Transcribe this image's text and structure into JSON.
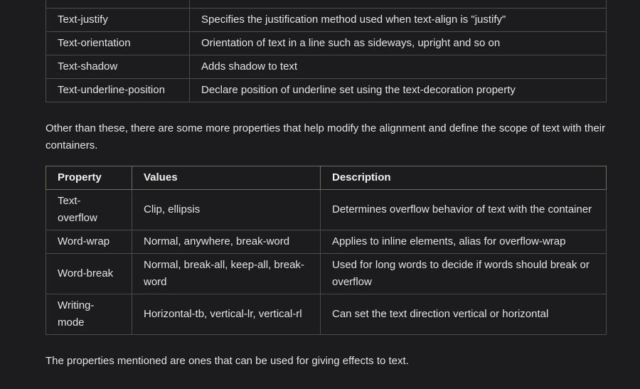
{
  "table1": {
    "rows": [
      {
        "property": "Text-justify",
        "description": "Specifies the justification method used when text-align is \"justify\""
      },
      {
        "property": "Text-orientation",
        "description": "Orientation of text in a line such as sideways, upright and so on"
      },
      {
        "property": "Text-shadow",
        "description": "Adds shadow to text"
      },
      {
        "property": "Text-underline-position",
        "description": "Declare position of underline set using the text-decoration property"
      }
    ]
  },
  "paragraph1": "Other than these, there are some more properties that help modify the alignment and define the scope of text with their containers.",
  "table2": {
    "headers": {
      "property": "Property",
      "values": "Values",
      "description": "Description"
    },
    "rows": [
      {
        "property": "Text-overflow",
        "values": "Clip, ellipsis",
        "description": "Determines overflow behavior of text with the container"
      },
      {
        "property": "Word-wrap",
        "values": "Normal, anywhere, break-word",
        "description": "Applies to inline elements, alias for overflow-wrap"
      },
      {
        "property": "Word-break",
        "values": "Normal, break-all, keep-all, break-word",
        "description": "Used for long words to decide if words should break or overflow"
      },
      {
        "property": "Writing-mode",
        "values": "Horizontal-tb, vertical-lr, vertical-rl",
        "description": "Can set the text direction vertical or horizontal"
      }
    ]
  },
  "paragraph2": "The properties mentioned are ones that can be used for giving effects to text."
}
